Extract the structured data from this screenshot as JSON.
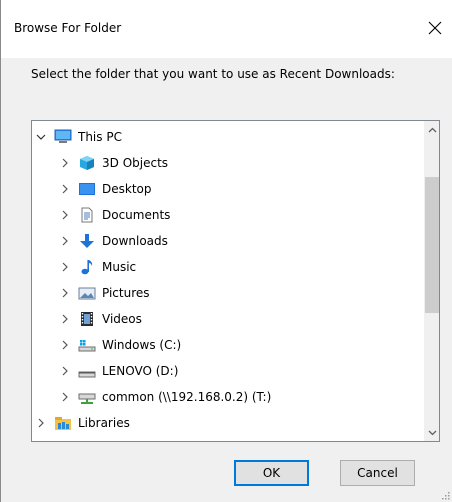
{
  "window": {
    "title": "Browse For Folder",
    "instruction": "Select the folder that you want to use as Recent Downloads:"
  },
  "tree": {
    "items": [
      {
        "label": "This PC",
        "icon": "monitor-icon",
        "expanded": true
      },
      {
        "label": "3D Objects",
        "icon": "3d-objects-icon"
      },
      {
        "label": "Desktop",
        "icon": "desktop-icon"
      },
      {
        "label": "Documents",
        "icon": "documents-icon"
      },
      {
        "label": "Downloads",
        "icon": "download-arrow-icon"
      },
      {
        "label": "Music",
        "icon": "music-note-icon"
      },
      {
        "label": "Pictures",
        "icon": "pictures-icon"
      },
      {
        "label": "Videos",
        "icon": "videos-icon"
      },
      {
        "label": "Windows (C:)",
        "icon": "windows-drive-icon"
      },
      {
        "label": "LENOVO (D:)",
        "icon": "drive-icon"
      },
      {
        "label": "common (\\\\192.168.0.2) (T:)",
        "icon": "network-drive-icon"
      },
      {
        "label": "Libraries",
        "icon": "libraries-icon"
      }
    ]
  },
  "buttons": {
    "ok": "OK",
    "cancel": "Cancel"
  },
  "colors": {
    "accent": "#0078d7",
    "dialog_bg": "#f0f0f0"
  }
}
